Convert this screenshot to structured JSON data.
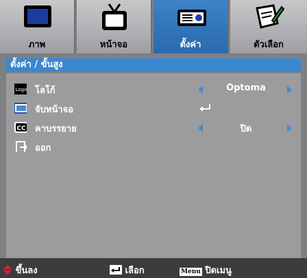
{
  "tabs": [
    {
      "label": "ภาพ",
      "icon": "monitor-icon",
      "active": false
    },
    {
      "label": "หน้าจอ",
      "icon": "tv-icon",
      "active": false
    },
    {
      "label": "ตั้งค่า",
      "icon": "projector-icon",
      "active": true
    },
    {
      "label": "ตัวเลือก",
      "icon": "edit-icon",
      "active": false
    }
  ],
  "title": "ตั้งค่า / ขั้นสูง",
  "menu": [
    {
      "icon": "logo-icon",
      "icon_text": "Logo",
      "label": "โลโก้",
      "value": "Optoma",
      "arrows": true
    },
    {
      "icon": "screen-capture-icon",
      "label": "จับหน้าจอ",
      "value": "",
      "enter": true
    },
    {
      "icon": "cc-icon",
      "icon_text": "CC",
      "label": "คาบรรยาย",
      "value": "ปิด",
      "arrows": true
    },
    {
      "icon": "exit-icon",
      "label": "ออก",
      "value": ""
    }
  ],
  "footer": {
    "move": "ขึ้นลง",
    "select": "เลือก",
    "menu_key": "Menu",
    "close": "ปิดเมนู"
  },
  "colors": {
    "accent": "#3b87cf",
    "panel": "#9c9c9f",
    "footer": "#3c3c3c"
  }
}
